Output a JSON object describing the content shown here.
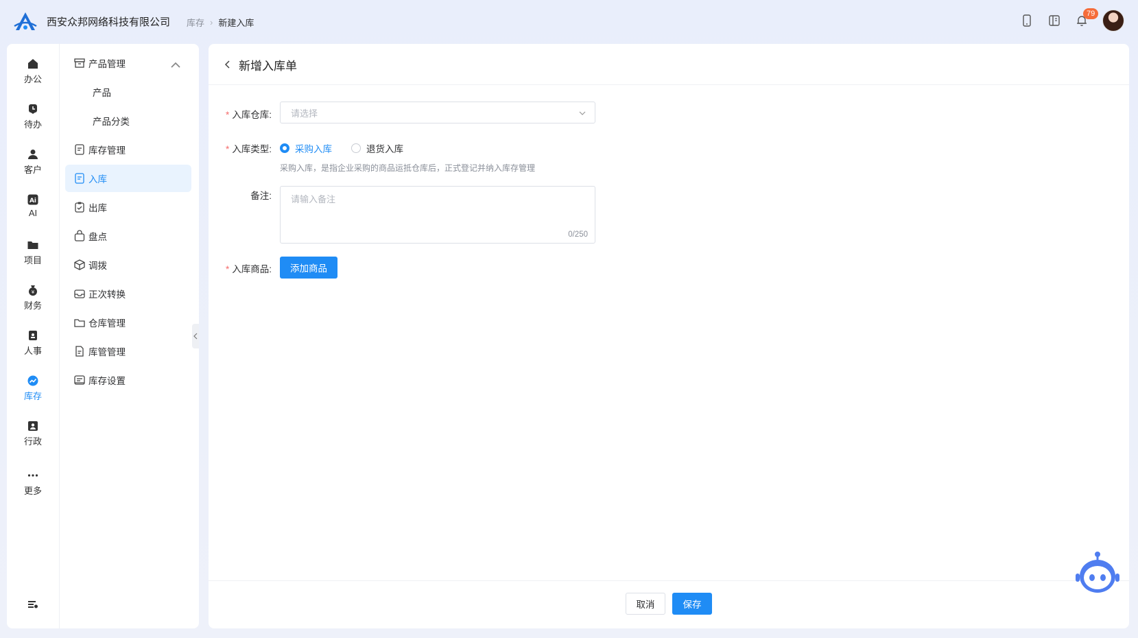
{
  "header": {
    "company": "西安众邦网络科技有限公司",
    "breadcrumb": [
      "库存",
      "新建入库"
    ],
    "notification_count": "79",
    "icons": [
      "mobile-icon",
      "book-icon",
      "bell-icon",
      "avatar"
    ]
  },
  "rail": {
    "items": [
      {
        "label": "办公",
        "icon": "home-icon"
      },
      {
        "label": "待办",
        "icon": "todo-icon"
      },
      {
        "label": "客户",
        "icon": "customer-icon"
      },
      {
        "label": "AI",
        "icon": "ai-icon"
      },
      {
        "label": "项目",
        "icon": "folder-icon"
      },
      {
        "label": "财务",
        "icon": "money-bag-icon"
      },
      {
        "label": "人事",
        "icon": "badge-icon"
      },
      {
        "label": "库存",
        "icon": "inventory-icon",
        "active": true
      },
      {
        "label": "行政",
        "icon": "admin-icon"
      },
      {
        "label": "更多",
        "icon": "more-icon"
      }
    ],
    "bottom_icon": "settings-list-icon"
  },
  "submenu": {
    "items": [
      {
        "label": "产品管理",
        "icon": "box-icon",
        "expanded": true
      },
      {
        "label": "产品",
        "sub": true
      },
      {
        "label": "产品分类",
        "sub": true
      },
      {
        "label": "库存管理",
        "icon": "doc-edit-icon"
      },
      {
        "label": "入库",
        "icon": "doc-in-icon",
        "active": true
      },
      {
        "label": "出库",
        "icon": "clipboard-check-icon"
      },
      {
        "label": "盘点",
        "icon": "bag-icon"
      },
      {
        "label": "调拨",
        "icon": "cube-icon"
      },
      {
        "label": "正次转换",
        "icon": "tray-icon"
      },
      {
        "label": "仓库管理",
        "icon": "folder-open-icon"
      },
      {
        "label": "库管管理",
        "icon": "file-icon"
      },
      {
        "label": "库存设置",
        "icon": "list-settings-icon"
      }
    ]
  },
  "page": {
    "title": "新增入库单",
    "warehouse_label": "入库仓库:",
    "warehouse_placeholder": "请选择",
    "type_label": "入库类型:",
    "type_options": [
      "采购入库",
      "退货入库"
    ],
    "type_selected": "采购入库",
    "type_hint": "采购入库，是指企业采购的商品运抵仓库后，正式登记并纳入库存管理",
    "remark_label": "备注:",
    "remark_placeholder": "请输入备注",
    "remark_count": "0/250",
    "goods_label": "入库商品:",
    "add_goods_button": "添加商品",
    "cancel_button": "取消",
    "save_button": "保存"
  },
  "colors": {
    "primary": "#1f8cf5",
    "required": "#f56c6c",
    "badge": "#f56c3a"
  }
}
